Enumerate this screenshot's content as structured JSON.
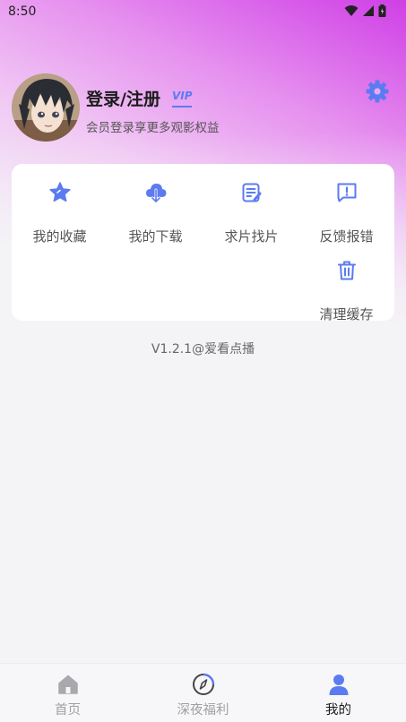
{
  "status_bar": {
    "time": "8:50"
  },
  "profile": {
    "title": "登录/注册",
    "vip_badge": "VIP",
    "subtitle": "会员登录享更多观影权益"
  },
  "menu": {
    "items": [
      {
        "label": "我的收藏",
        "icon": "star-icon"
      },
      {
        "label": "我的下载",
        "icon": "cloud-download-icon"
      },
      {
        "label": "求片找片",
        "icon": "request-list-icon"
      },
      {
        "label": "反馈报错",
        "icon": "feedback-icon"
      },
      {
        "label": "清理缓存",
        "icon": "trash-icon"
      }
    ]
  },
  "version_text": "V1.2.1@爱看点播",
  "bottom_nav": {
    "items": [
      {
        "label": "首页",
        "icon": "home-icon",
        "active": false
      },
      {
        "label": "深夜福利",
        "icon": "compass-icon",
        "active": false
      },
      {
        "label": "我的",
        "icon": "person-icon",
        "active": true
      }
    ]
  },
  "colors": {
    "accent": "#5c7bf0",
    "header_gradient_start": "#cf3fe6",
    "page_bg": "#f4f4f6"
  }
}
